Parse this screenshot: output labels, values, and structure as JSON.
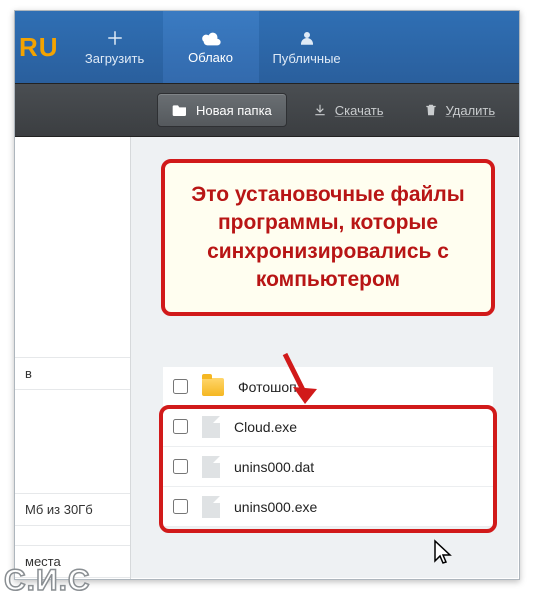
{
  "logo_fragment": "RU",
  "nav": {
    "upload": "Загрузить",
    "cloud": "Облако",
    "public": "Публичные"
  },
  "toolbar": {
    "new_folder": "Новая папка",
    "download": "Скачать",
    "delete": "Удалить"
  },
  "sidebar": {
    "frag1": "в",
    "storage": "Мб из 30Гб",
    "frag2": "места"
  },
  "callout_text": "Это установочные файлы программы, которые синхронизировались с компьютером",
  "files": {
    "folder": "Фотошоп",
    "f1": "Cloud.exe",
    "f2": "unins000.dat",
    "f3": "unins000.exe"
  },
  "watermark": "С.И.С"
}
